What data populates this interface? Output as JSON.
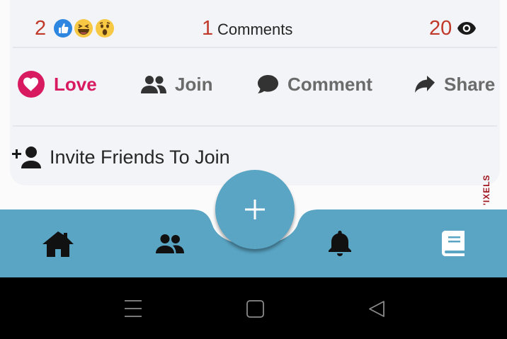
{
  "stats": {
    "likes_count": "2",
    "comments_count": "1",
    "comments_label": "Comments",
    "views_count": "20"
  },
  "actions": {
    "love": "Love",
    "join": "Join",
    "comment": "Comment",
    "share": "Share"
  },
  "invite": {
    "label": "Invite Friends To Join"
  },
  "watermark": "'IXELS",
  "icons": {
    "reactions": [
      "like-reaction-icon",
      "laugh-reaction-icon",
      "wow-reaction-icon"
    ],
    "views": "eye-icon",
    "nav": [
      "home-icon",
      "groups-icon",
      "bell-icon",
      "book-icon"
    ],
    "fab": "plus-icon"
  },
  "colors": {
    "accent": "#5aa5c4",
    "love": "#d81b60",
    "count": "#c0392b",
    "action_gray": "#6b6b6b"
  }
}
